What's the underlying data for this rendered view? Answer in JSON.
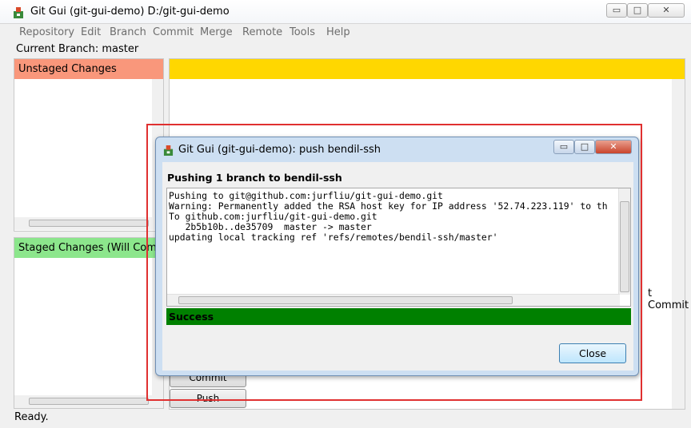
{
  "window": {
    "title": "Git Gui (git-gui-demo) D:/git-gui-demo",
    "controls": {
      "minimize": "▭",
      "maximize": "□",
      "close": "✕"
    }
  },
  "menu": [
    "Repository",
    "Edit",
    "Branch",
    "Commit",
    "Merge",
    "Remote",
    "Tools",
    "Help"
  ],
  "branch_line": "Current Branch: master",
  "unstaged": {
    "header": "Unstaged Changes"
  },
  "staged": {
    "header": "Staged Changes (Will Commit)"
  },
  "right_partial_label": "t Commit",
  "buttons": {
    "commit": "Commit",
    "push": "Push"
  },
  "status": "Ready.",
  "dialog": {
    "title": "Git Gui (git-gui-demo): push bendil-ssh",
    "heading": "Pushing 1 branch to bendil-ssh",
    "console_lines": [
      "Pushing to git@github.com:jurfliu/git-gui-demo.git",
      "Warning: Permanently added the RSA host key for IP address '52.74.223.119' to th",
      "To github.com:jurfliu/git-gui-demo.git",
      "   2b5b10b..de35709  master -> master",
      "updating local tracking ref 'refs/remotes/bendil-ssh/master'"
    ],
    "status": "Success",
    "close_label": "Close"
  },
  "colors": {
    "unstaged_header": "#f9977b",
    "staged_header": "#8ce68c",
    "diff_header": "#ffd700",
    "success": "#008000",
    "highlight": "#e03030"
  },
  "icons": [
    "git-icon",
    "minimize-icon",
    "maximize-icon",
    "close-icon"
  ]
}
